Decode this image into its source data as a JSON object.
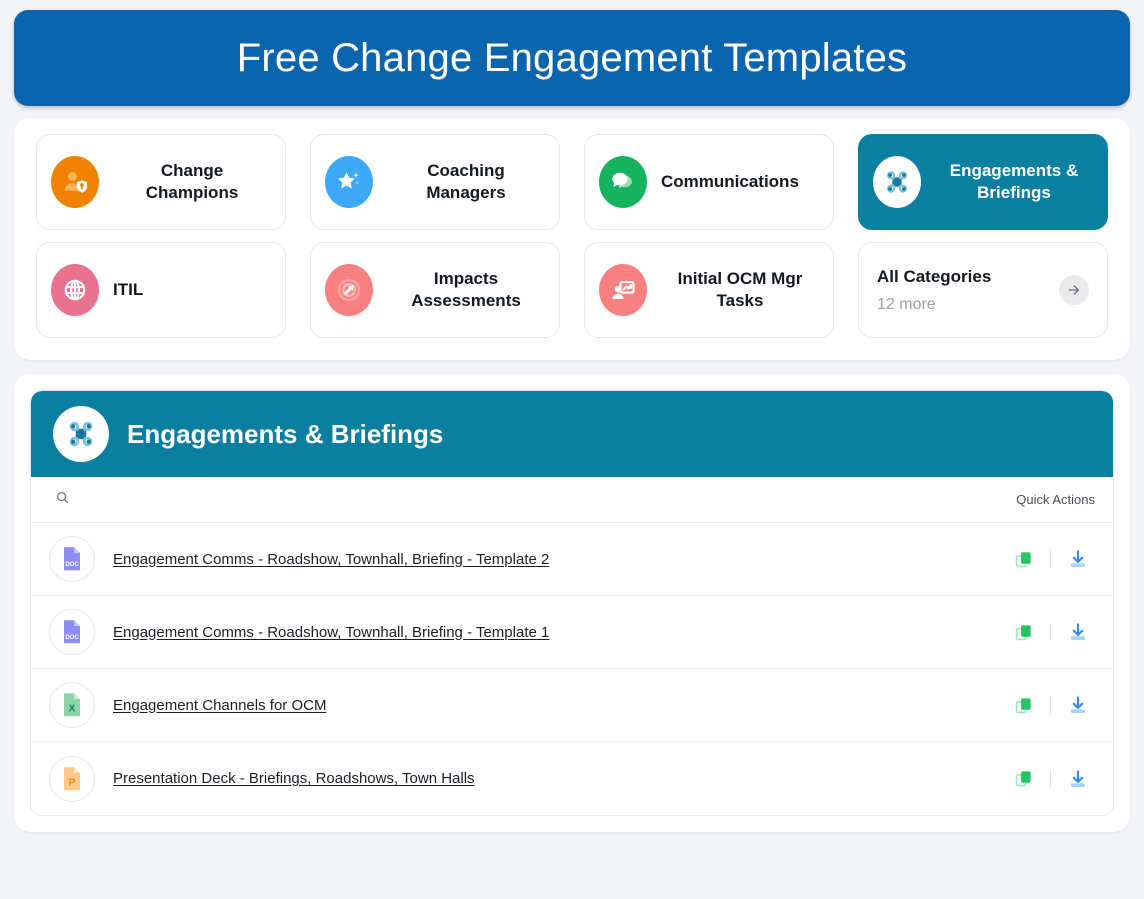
{
  "banner": {
    "title": "Free Change Engagement Templates",
    "bg_color": "#0a65ae"
  },
  "categories": {
    "items": [
      {
        "label": "Change Champions",
        "icon": "person-shield-icon",
        "icon_color": "#EF8300",
        "active": false
      },
      {
        "label": "Coaching Managers",
        "icon": "star-sparkle-icon",
        "icon_color": "#3DA8F5",
        "active": false
      },
      {
        "label": "Communications",
        "icon": "chat-bubbles-icon",
        "icon_color": "#16B35F",
        "active": false
      },
      {
        "label": "Engagements & Briefings",
        "icon": "command-network-icon",
        "icon_color": "#ffffff",
        "active": true
      },
      {
        "label": "ITIL",
        "icon": "globe-icon",
        "icon_color": "#E9738E",
        "active": false
      },
      {
        "label": "Impacts Assessments",
        "icon": "target-arrow-icon",
        "icon_color": "#F98080",
        "active": false
      },
      {
        "label": "Initial OCM Mgr Tasks",
        "icon": "person-board-icon",
        "icon_color": "#F98080",
        "active": false
      }
    ],
    "all_categories": {
      "title": "All Categories",
      "subtitle": "12 more",
      "arrow_icon": "arrow-right-icon"
    },
    "active_color": "#0b7fa0"
  },
  "files_panel": {
    "header": {
      "title": "Engagements & Briefings",
      "icon": "command-network-icon",
      "bg_color": "#0b7fa0"
    },
    "toolbar": {
      "search_placeholder": "",
      "search_value": "",
      "search_icon": "search-icon",
      "quick_actions_label": "Quick Actions"
    },
    "rows": [
      {
        "name": "Engagement Comms - Roadshow, Townhall, Briefing - Template 2",
        "file_type": "DOC",
        "type_label": "DOC"
      },
      {
        "name": "Engagement Comms - Roadshow, Townhall, Briefing - Template 1",
        "file_type": "DOC",
        "type_label": "DOC"
      },
      {
        "name": "Engagement Channels for OCM",
        "file_type": "XLS",
        "type_label": "X"
      },
      {
        "name": "Presentation Deck - Briefings, Roadshows, Town Halls",
        "file_type": "PPT",
        "type_label": "P"
      }
    ],
    "row_actions": {
      "copy_icon": "copy-icon",
      "copy_color": "#22c55e",
      "download_icon": "download-icon",
      "download_color": "#3b9df5"
    }
  }
}
